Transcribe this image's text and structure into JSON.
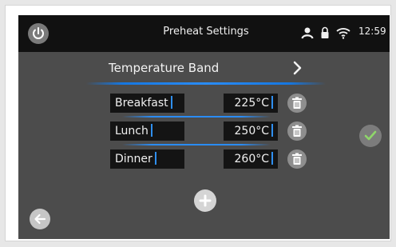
{
  "header": {
    "title": "Preheat Settings",
    "time": "12:59",
    "icons": [
      "power-icon",
      "user-icon",
      "lock-icon",
      "wifi-icon"
    ]
  },
  "band": {
    "label": "Temperature Band",
    "chevron_icon": "chevron-right-icon"
  },
  "rows": [
    {
      "name": "Breakfast",
      "temperature": "225°C"
    },
    {
      "name": "Lunch",
      "temperature": "250°C"
    },
    {
      "name": "Dinner",
      "temperature": "260°C"
    }
  ],
  "actions": {
    "confirm_icon": "check-icon",
    "add_icon": "plus-icon",
    "back_icon": "arrow-left-icon",
    "delete_icon": "trash-icon"
  },
  "colors": {
    "accent": "#2a8cf5",
    "confirm_check": "#8fd66a"
  }
}
